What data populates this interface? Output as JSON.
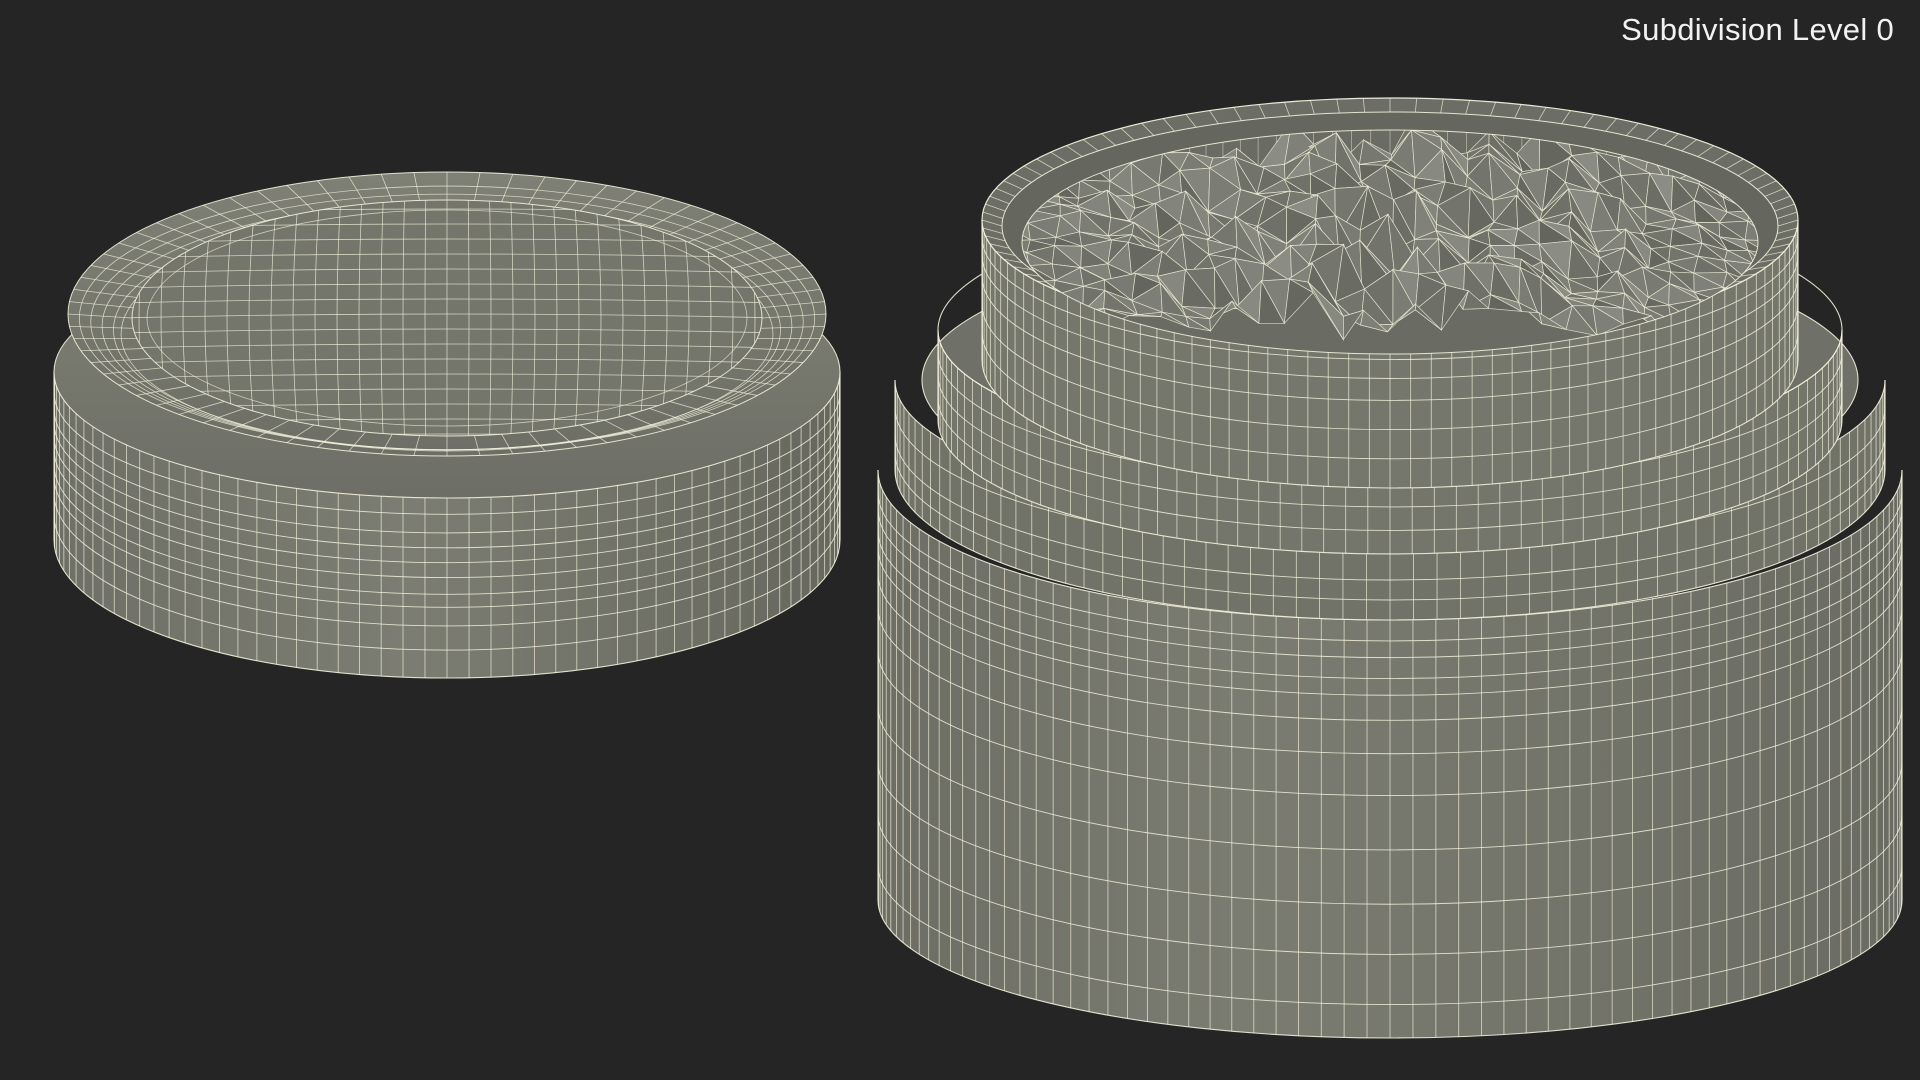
{
  "viewport": {
    "subdivision_label": "Subdivision Level 0",
    "background_color": "#252525",
    "mesh_fill_color": "#77786d",
    "wire_color": "#f3f1dc"
  }
}
